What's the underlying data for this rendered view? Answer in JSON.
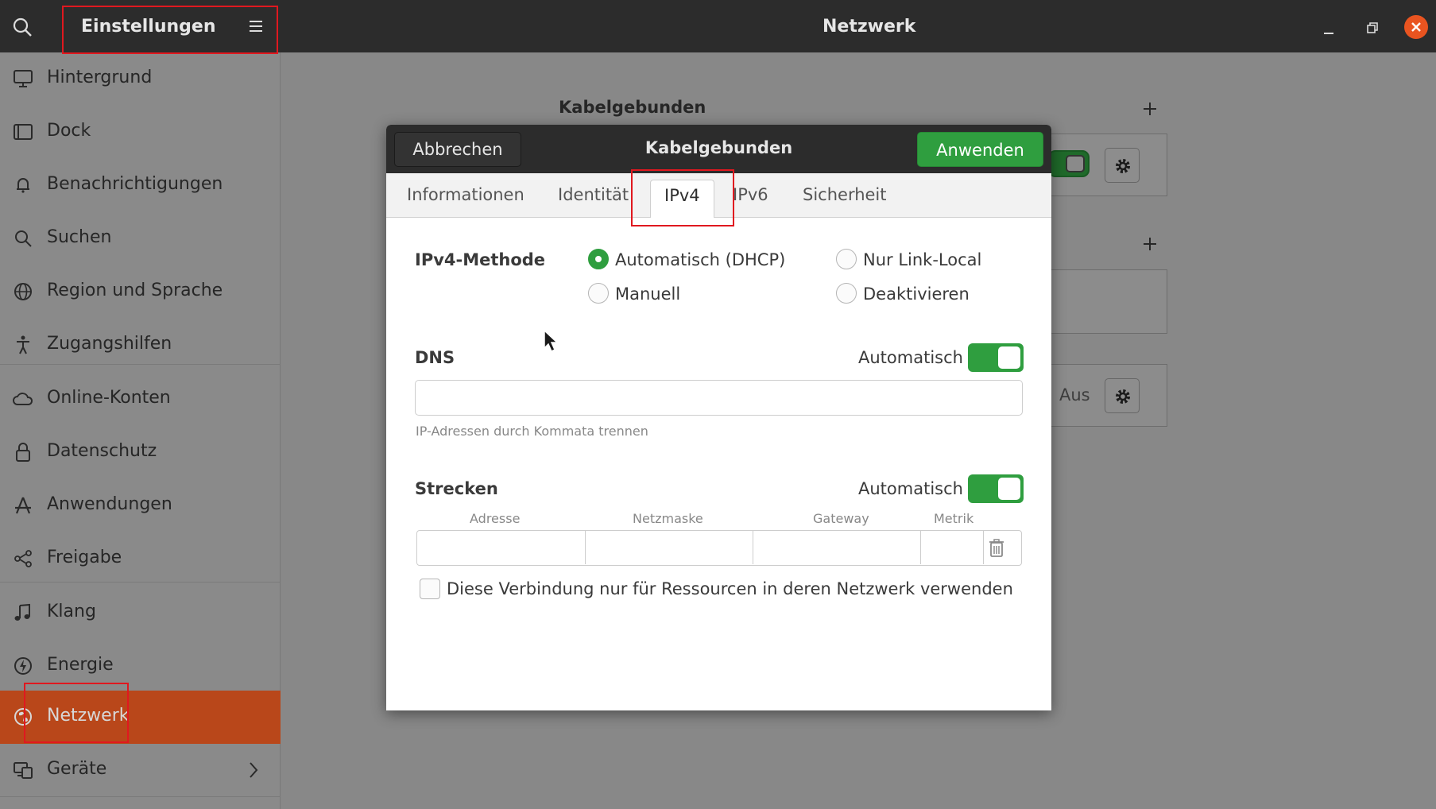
{
  "header": {
    "left_title": "Einstellungen",
    "center_title": "Netzwerk",
    "icons": [
      "search-icon",
      "hamburger-menu-icon",
      "minimize-icon",
      "maximize-icon",
      "close-icon"
    ]
  },
  "sidebar": {
    "items": [
      {
        "label": "Hintergrund",
        "icon": "monitor-icon"
      },
      {
        "label": "Dock",
        "icon": "dock-icon"
      },
      {
        "label": "Benachrichtigungen",
        "icon": "bell-icon"
      },
      {
        "label": "Suchen",
        "icon": "search-icon"
      },
      {
        "label": "Region und Sprache",
        "icon": "globe-icon"
      },
      {
        "label": "Zugangshilfen",
        "icon": "accessibility-icon"
      },
      {
        "label": "Online-Konten",
        "icon": "cloud-icon"
      },
      {
        "label": "Datenschutz",
        "icon": "lock-icon"
      },
      {
        "label": "Anwendungen",
        "icon": "applications-icon"
      },
      {
        "label": "Freigabe",
        "icon": "share-icon"
      },
      {
        "label": "Klang",
        "icon": "music-note-icon"
      },
      {
        "label": "Energie",
        "icon": "power-icon"
      },
      {
        "label": "Netzwerk",
        "icon": "network-icon",
        "active": true
      },
      {
        "label": "Geräte",
        "icon": "devices-icon"
      }
    ],
    "active_color": "#b9471a"
  },
  "background": {
    "section_title": "Kabelgebunden",
    "aus_label": "Aus"
  },
  "dialog": {
    "title": "Kabelgebunden",
    "cancel_label": "Abbrechen",
    "apply_label": "Anwenden",
    "accent_color": "#2f9e3f",
    "tabs": [
      {
        "label": "Informationen"
      },
      {
        "label": "Identität"
      },
      {
        "label": "IPv4",
        "active": true
      },
      {
        "label": "IPv6"
      },
      {
        "label": "Sicherheit"
      }
    ],
    "ipv4": {
      "method_label": "IPv4-Methode",
      "options": [
        {
          "label": "Automatisch (DHCP)",
          "checked": true
        },
        {
          "label": "Nur Link-Local",
          "checked": false
        },
        {
          "label": "Manuell",
          "checked": false
        },
        {
          "label": "Deaktivieren",
          "checked": false
        }
      ]
    },
    "dns": {
      "label": "DNS",
      "auto_label": "Automatisch",
      "auto_on": true,
      "value": "",
      "hint": "IP-Adressen durch Kommata trennen"
    },
    "routes": {
      "label": "Strecken",
      "auto_label": "Automatisch",
      "auto_on": true,
      "columns": [
        "Adresse",
        "Netzmaske",
        "Gateway",
        "Metrik"
      ],
      "rows": [
        {
          "address": "",
          "netmask": "",
          "gateway": "",
          "metric": ""
        }
      ]
    },
    "local_only_label": "Diese Verbindung nur für Ressourcen in deren Netzwerk verwenden",
    "local_only_checked": false
  }
}
